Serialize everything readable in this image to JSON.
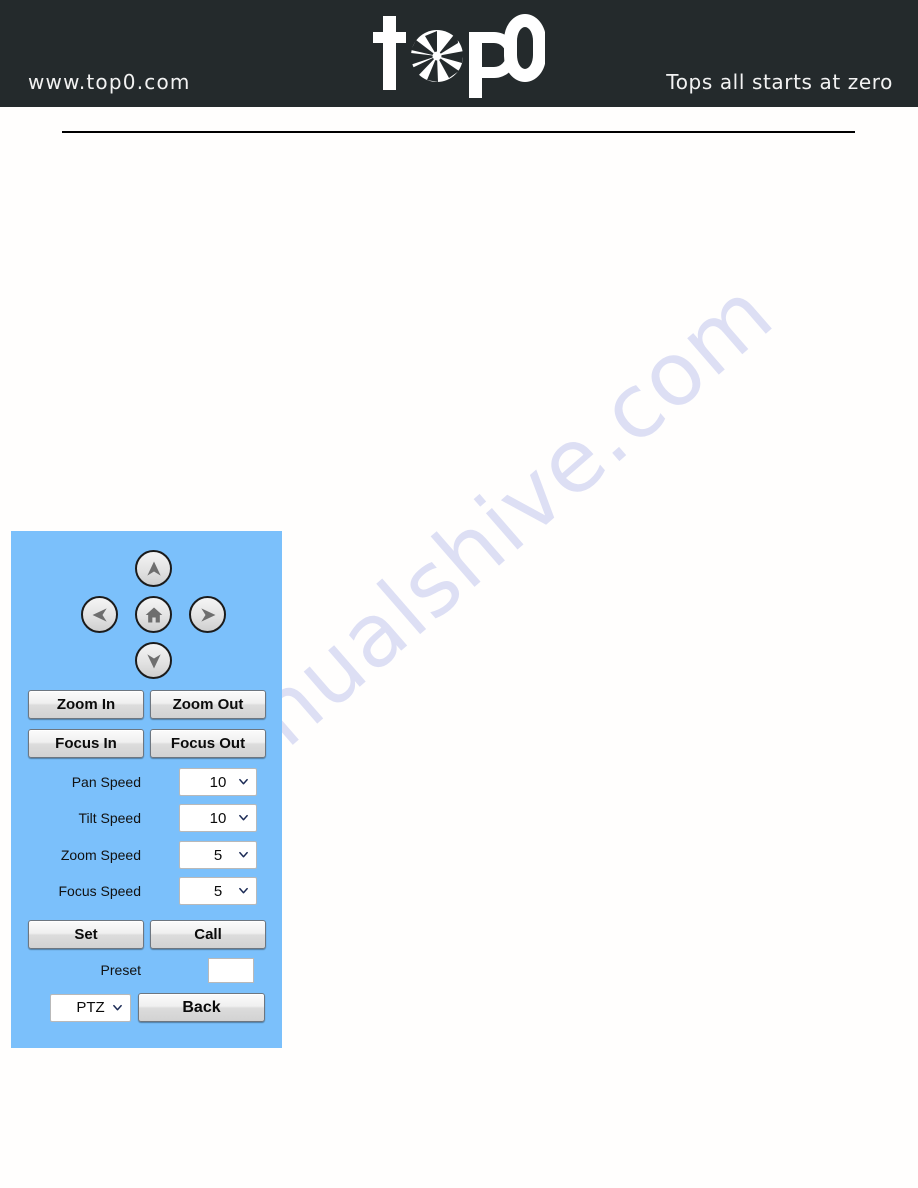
{
  "header": {
    "url": "www.top0.com",
    "tagline": "Tops all starts at zero",
    "logo_text": "top0",
    "logo_icon": "camera-aperture-icon",
    "background_color": "#242a2c",
    "text_color": "#f2f2f2"
  },
  "watermark": {
    "text": "manualshive.com",
    "color": "#c9cdf0"
  },
  "ptz_panel": {
    "background_color": "#7bc0fb",
    "dpad": {
      "up_label": "up-arrow",
      "left_label": "left-arrow",
      "home_label": "home",
      "right_label": "right-arrow",
      "down_label": "down-arrow"
    },
    "buttons": {
      "zoom_in": "Zoom In",
      "zoom_out": "Zoom Out",
      "focus_in": "Focus In",
      "focus_out": "Focus Out",
      "set": "Set",
      "call": "Call",
      "back": "Back"
    },
    "speeds": [
      {
        "label": "Pan Speed",
        "value": "10"
      },
      {
        "label": "Tilt Speed",
        "value": "10"
      },
      {
        "label": "Zoom Speed",
        "value": "5"
      },
      {
        "label": "Focus Speed",
        "value": "5"
      }
    ],
    "preset": {
      "label": "Preset",
      "value": ""
    },
    "mode_select": {
      "value": "PTZ"
    }
  }
}
